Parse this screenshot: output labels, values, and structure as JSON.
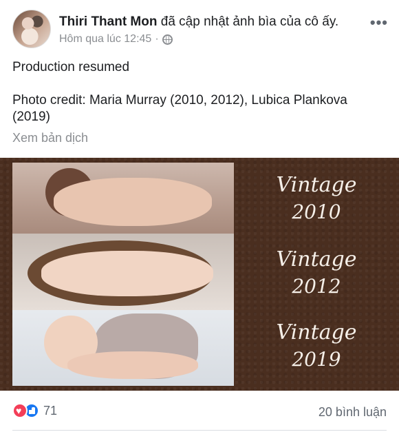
{
  "post": {
    "author": "Thiri Thant Mon",
    "action": "đã cập nhật ảnh bìa của cô ấy.",
    "timestamp": "Hôm qua lúc 12:45",
    "separator": "·",
    "privacy_icon": "globe-icon",
    "more_label": "•••",
    "text_line1": "Production resumed",
    "text_line2": "Photo credit: Maria Murray (2010, 2012), Lubica Plankova (2019)",
    "translate_label": "Xem bản dịch"
  },
  "cover_image": {
    "labels": [
      {
        "word": "Vintage",
        "year": "2010"
      },
      {
        "word": "Vintage",
        "year": "2012"
      },
      {
        "word": "Vintage",
        "year": "2019"
      }
    ],
    "background_color": "#4a2e1f"
  },
  "footer": {
    "reaction_icons": [
      "love-icon",
      "like-icon"
    ],
    "reaction_count": "71",
    "comment_count": "20 bình luận"
  }
}
